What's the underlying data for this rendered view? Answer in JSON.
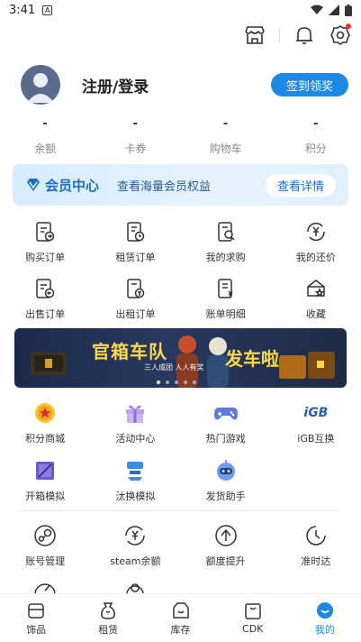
{
  "status_bar": {
    "time": "3:41",
    "a_label": "A"
  },
  "profile": {
    "login_label": "注册/登录",
    "sign_label": "签到领奖"
  },
  "stats": [
    {
      "value": "-",
      "label": "余额"
    },
    {
      "value": "-",
      "label": "卡券"
    },
    {
      "value": "-",
      "label": "购物车"
    },
    {
      "value": "-",
      "label": "积分"
    }
  ],
  "member": {
    "title": "会员中心",
    "subtitle": "查看海量会员权益",
    "button": "查看详情"
  },
  "orders_row1": [
    {
      "label": "购买订单",
      "icon": "doc-arrow-icon"
    },
    {
      "label": "租赁订单",
      "icon": "doc-clock-icon"
    },
    {
      "label": "我的求购",
      "icon": "doc-search-icon"
    },
    {
      "label": "我的还价",
      "icon": "yen-refresh-icon"
    }
  ],
  "orders_row2": [
    {
      "label": "出售订单",
      "icon": "doc-back-icon"
    },
    {
      "label": "出租订单",
      "icon": "doc-yen-icon"
    },
    {
      "label": "账单明细",
      "icon": "bill-icon"
    },
    {
      "label": "收藏",
      "icon": "box-star-icon"
    }
  ],
  "banner": {
    "title_left": "官箱车队",
    "title_right": "发车啦",
    "tagline": "三人成团 人人有奖",
    "slide_count": 5,
    "active_slide": 1
  },
  "services_row1": [
    {
      "label": "积分商城",
      "icon": "points-star-icon"
    },
    {
      "label": "活动中心",
      "icon": "gift-icon"
    },
    {
      "label": "热门游戏",
      "icon": "gamepad-icon"
    },
    {
      "label": "iGB互换",
      "icon": "igb-logo-icon",
      "logo_text": "iGB"
    }
  ],
  "services_row2": [
    {
      "label": "开箱模拟",
      "icon": "crate-icon"
    },
    {
      "label": "汰换模拟",
      "icon": "exchange-icon"
    },
    {
      "label": "发货助手",
      "icon": "robot-icon"
    }
  ],
  "account_row": [
    {
      "label": "账号管理",
      "icon": "steam-icon"
    },
    {
      "label": "steam余额",
      "icon": "yen-cycle-icon"
    },
    {
      "label": "额度提升",
      "icon": "up-circle-icon"
    },
    {
      "label": "准时达",
      "icon": "clock-icon"
    }
  ],
  "tabbar": [
    {
      "label": "饰品",
      "icon": "box-tab-icon",
      "active": false
    },
    {
      "label": "租赁",
      "icon": "bag-tab-icon",
      "active": false
    },
    {
      "label": "库存",
      "icon": "inventory-tab-icon",
      "active": false
    },
    {
      "label": "CDK",
      "icon": "cdk-tab-icon",
      "active": false
    },
    {
      "label": "我的",
      "icon": "profile-tab-icon",
      "active": true
    }
  ],
  "colors": {
    "accent": "#1e88e5",
    "member_text": "#1f6fc7",
    "banner_bg": "#1b2a48",
    "banner_title": "#ffd84a"
  }
}
